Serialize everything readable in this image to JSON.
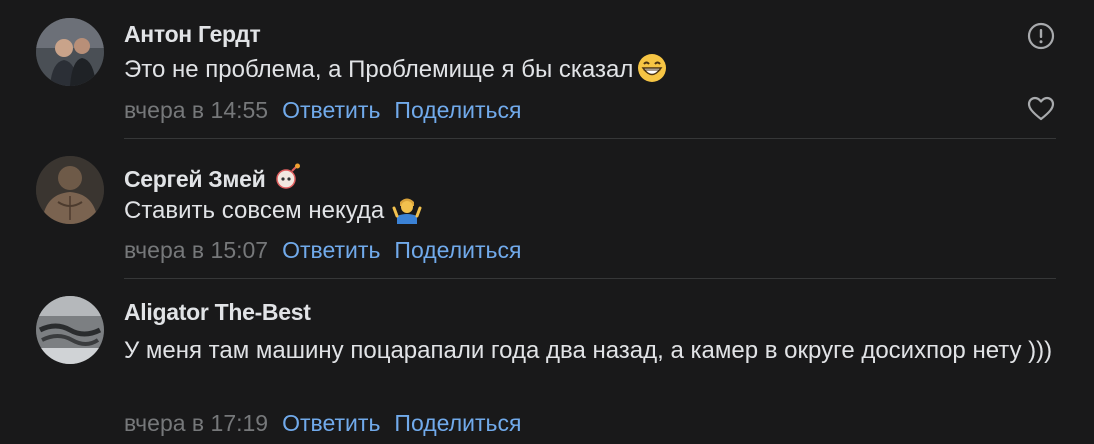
{
  "comments": [
    {
      "author": "Антон Гердт",
      "text": "Это не проблема, а Проблемище я бы сказал",
      "text_emoji": "grinning-face-emoji",
      "time": "вчера в 14:55",
      "reply_label": "Ответить",
      "share_label": "Поделиться"
    },
    {
      "author": "Сергей Змей",
      "author_badge": "bomb-badge-icon",
      "text": "Ставить совсем некуда",
      "text_emoji": "person-shrugging-emoji",
      "time": "вчера в 15:07",
      "reply_label": "Ответить",
      "share_label": "Поделиться"
    },
    {
      "author": "Aligator The-Best",
      "text": "У меня там машину поцарапали года два назад, а камер в округе досихпор нету )))",
      "time": "вчера в 17:19",
      "reply_label": "Ответить",
      "share_label": "Поделиться"
    }
  ],
  "icons": {
    "report": "exclamation-circle-icon",
    "like": "heart-outline-icon"
  },
  "colors": {
    "background": "#19191a",
    "text": "#e1e3e6",
    "muted": "#76787a",
    "link": "#71aaeb"
  }
}
